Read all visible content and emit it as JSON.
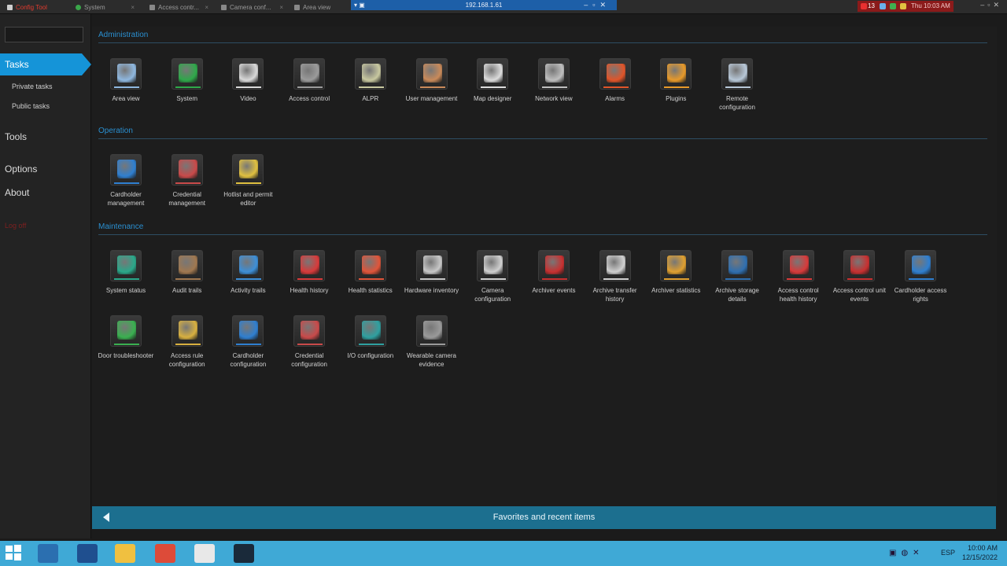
{
  "tabs": [
    {
      "label": "Config Tool",
      "color": "#e23b2e"
    },
    {
      "label": "System"
    },
    {
      "label": "Access contr..."
    },
    {
      "label": "Camera conf..."
    },
    {
      "label": "Area view"
    }
  ],
  "remote": {
    "address": "192.168.1.61"
  },
  "notifications": {
    "count": "13",
    "time": "Thu 10:03 AM"
  },
  "sidebar": {
    "search_placeholder": "",
    "tasks_label": "Tasks",
    "private_tasks": "Private tasks",
    "public_tasks": "Public tasks",
    "tools_label": "Tools",
    "options_label": "Options",
    "about_label": "About",
    "logoff_label": "Log off"
  },
  "sections": {
    "administration": {
      "title": "Administration",
      "items": [
        {
          "label": "Area view",
          "icon": "area-view-icon",
          "color": "#8fb8e0"
        },
        {
          "label": "System",
          "icon": "globe-icon",
          "color": "#2fa84a"
        },
        {
          "label": "Video",
          "icon": "camera-icon",
          "color": "#d9d9d9"
        },
        {
          "label": "Access control",
          "icon": "door-controller-icon",
          "color": "#9b9b9b"
        },
        {
          "label": "ALPR",
          "icon": "license-plate-icon",
          "color": "#c8c8a0"
        },
        {
          "label": "User management",
          "icon": "user-icon",
          "color": "#c98a5a"
        },
        {
          "label": "Map designer",
          "icon": "map-icon",
          "color": "#dcdcdc"
        },
        {
          "label": "Network view",
          "icon": "network-icon",
          "color": "#bfbfbf"
        },
        {
          "label": "Alarms",
          "icon": "alarm-icon",
          "color": "#e0552a"
        },
        {
          "label": "Plugins",
          "icon": "puzzle-icon",
          "color": "#e89a2a"
        },
        {
          "label": "Remote configuration",
          "icon": "remote-config-icon",
          "color": "#b8c8d8"
        }
      ]
    },
    "operation": {
      "title": "Operation",
      "items": [
        {
          "label": "Cardholder management",
          "icon": "cardholder-icon",
          "color": "#2f7fd0"
        },
        {
          "label": "Credential management",
          "icon": "credential-card-icon",
          "color": "#c94a4a"
        },
        {
          "label": "Hotlist and permit editor",
          "icon": "badge-star-icon",
          "color": "#e0c040"
        }
      ]
    },
    "maintenance": {
      "title": "Maintenance",
      "items": [
        {
          "label": "System status",
          "icon": "heartbeat-monitor-icon",
          "color": "#2aa88a"
        },
        {
          "label": "Audit trails",
          "icon": "audit-door-icon",
          "color": "#a07850"
        },
        {
          "label": "Activity trails",
          "icon": "clock-document-icon",
          "color": "#3d8fd8"
        },
        {
          "label": "Health history",
          "icon": "health-calendar-icon",
          "color": "#d83a3a"
        },
        {
          "label": "Health statistics",
          "icon": "health-chart-icon",
          "color": "#e0553a"
        },
        {
          "label": "Hardware inventory",
          "icon": "hardware-icon",
          "color": "#c8c8c8"
        },
        {
          "label": "Camera configuration",
          "icon": "camera-doc-icon",
          "color": "#d0d0d0"
        },
        {
          "label": "Archiver events",
          "icon": "archiver-events-icon",
          "color": "#c83030"
        },
        {
          "label": "Archive transfer history",
          "icon": "archive-transfer-icon",
          "color": "#d0d0d0"
        },
        {
          "label": "Archiver statistics",
          "icon": "archiver-stats-icon",
          "color": "#e0a030"
        },
        {
          "label": "Archive storage details",
          "icon": "storage-info-icon",
          "color": "#2f6fb0"
        },
        {
          "label": "Access control health history",
          "icon": "controller-health-icon",
          "color": "#d83a3a"
        },
        {
          "label": "Access control unit events",
          "icon": "unit-events-icon",
          "color": "#c83030"
        },
        {
          "label": "Cardholder access rights",
          "icon": "access-rights-icon",
          "color": "#2f7fd0"
        },
        {
          "label": "Door troubleshooter",
          "icon": "door-plus-icon",
          "color": "#3ab050"
        },
        {
          "label": "Access rule configuration",
          "icon": "access-rule-icon",
          "color": "#d8b040"
        },
        {
          "label": "Cardholder configuration",
          "icon": "cardholder-config-icon",
          "color": "#2f7fd0"
        },
        {
          "label": "Credential configuration",
          "icon": "credential-config-icon",
          "color": "#c94a4a"
        },
        {
          "label": "I/O configuration",
          "icon": "io-config-icon",
          "color": "#2fa0a0"
        },
        {
          "label": "Wearable camera evidence",
          "icon": "bodycam-icon",
          "color": "#9a9a9a"
        }
      ]
    }
  },
  "favorites": {
    "label": "Favorites and recent items"
  },
  "taskbar": {
    "apps": [
      {
        "icon": "windows-start-icon",
        "color": "#ffffff"
      },
      {
        "icon": "server-manager-icon",
        "color": "#2b6fb0"
      },
      {
        "icon": "powershell-icon",
        "color": "#1f4f8f"
      },
      {
        "icon": "file-explorer-icon",
        "color": "#f0c040"
      },
      {
        "icon": "chrome-icon",
        "color": "#dd4b39"
      },
      {
        "icon": "config-tool-icon",
        "color": "#e8e8e8"
      },
      {
        "icon": "security-desk-icon",
        "color": "#1a2a3a"
      }
    ],
    "lang": "ESP",
    "time": "10:00 AM",
    "date": "12/15/2022"
  }
}
